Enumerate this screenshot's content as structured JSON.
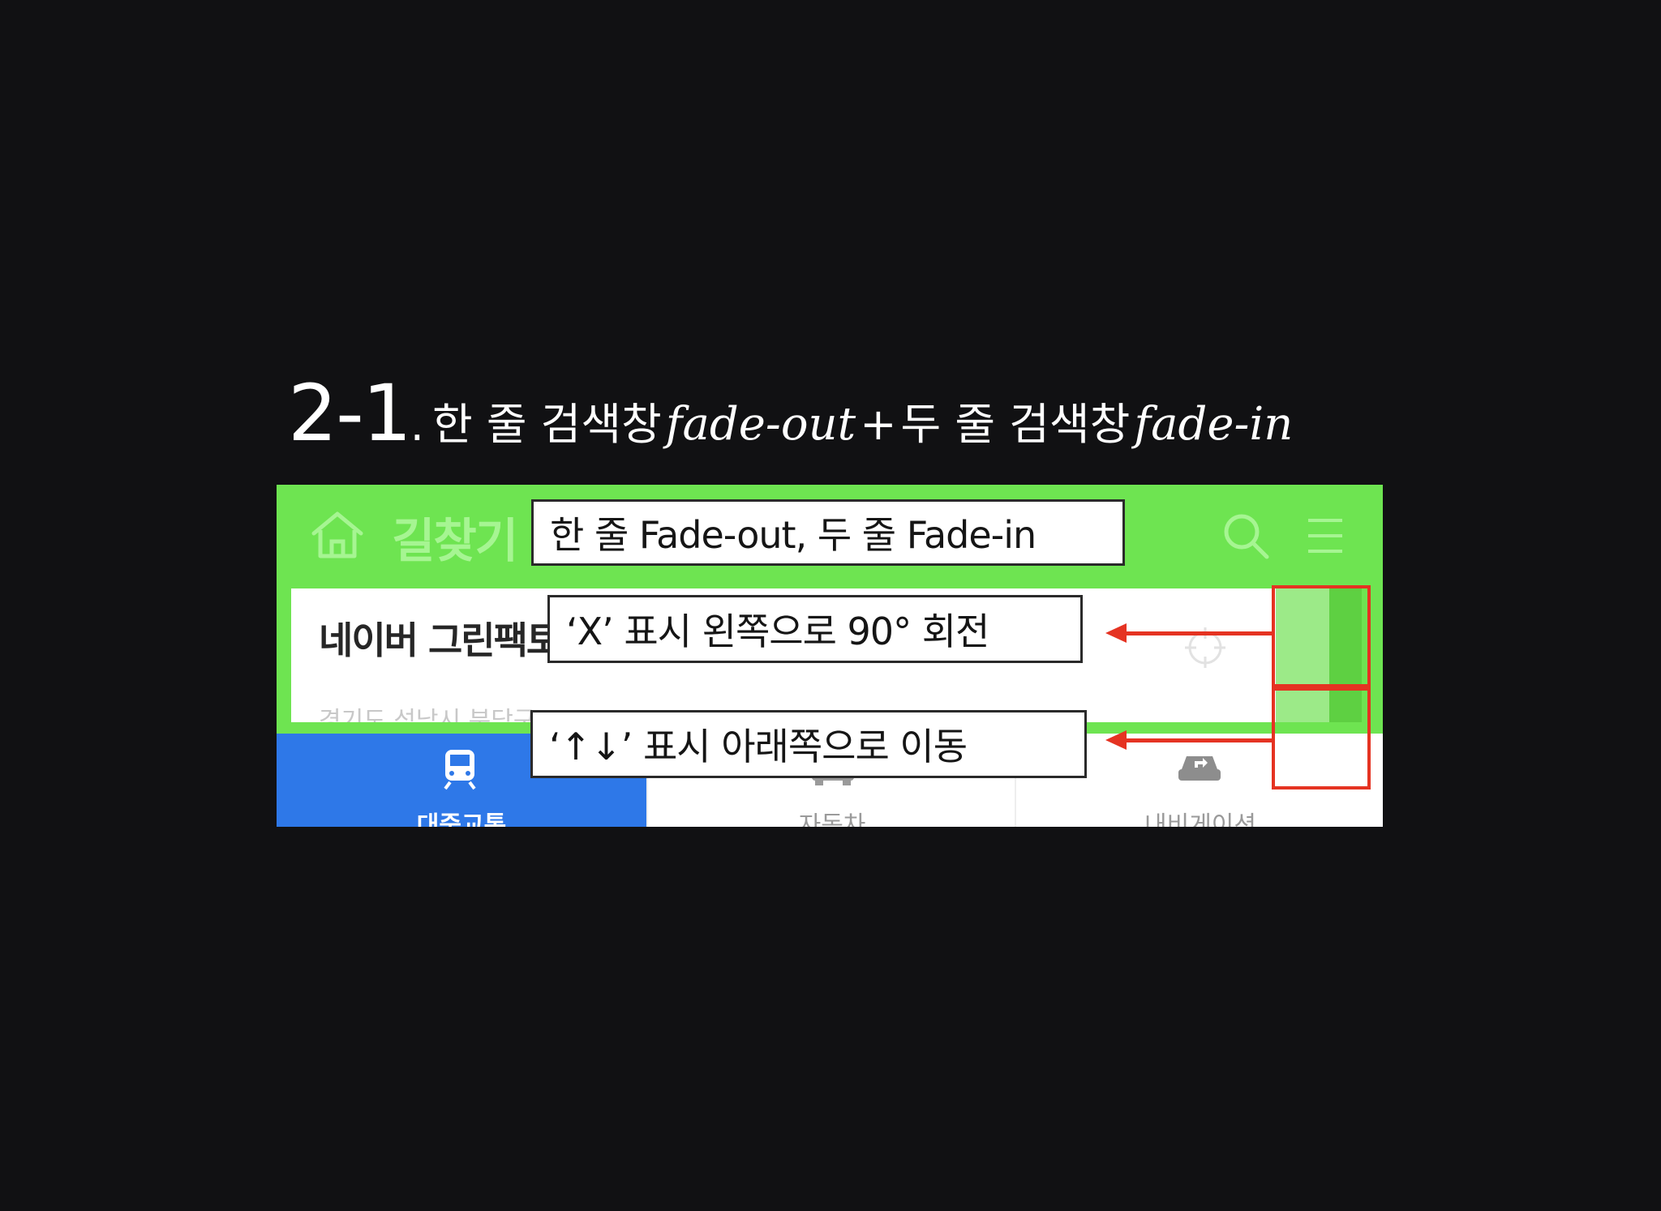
{
  "slide": {
    "title_number": "2-1",
    "title_dot": ".",
    "title_part1": "한 줄 검색창",
    "title_italic1": "fade-out",
    "title_plus": "+",
    "title_part2": "두 줄 검색창",
    "title_italic2": "fade-in"
  },
  "app": {
    "title": "길찾기",
    "search_text": "네이버 그린팩토리",
    "sub_text": "경기도 성남시 분당구",
    "tabs": [
      {
        "label": "대중교통",
        "icon": "train-icon",
        "active": true
      },
      {
        "label": "자동차",
        "icon": "car-icon",
        "active": false
      },
      {
        "label": "내비게이션",
        "icon": "navigation-icon",
        "active": false
      }
    ]
  },
  "annotations": {
    "callout_1": "한 줄 Fade-out, 두 줄 Fade-in",
    "callout_2": "‘X’ 표시 왼쪽으로 90° 회전",
    "callout_3": "‘↑↓’ 표시 아래쪽으로 이동"
  },
  "colors": {
    "background": "#111113",
    "app_green": "#6ee451",
    "tab_active_blue": "#2e78e8",
    "annotation_red": "#e53322"
  }
}
